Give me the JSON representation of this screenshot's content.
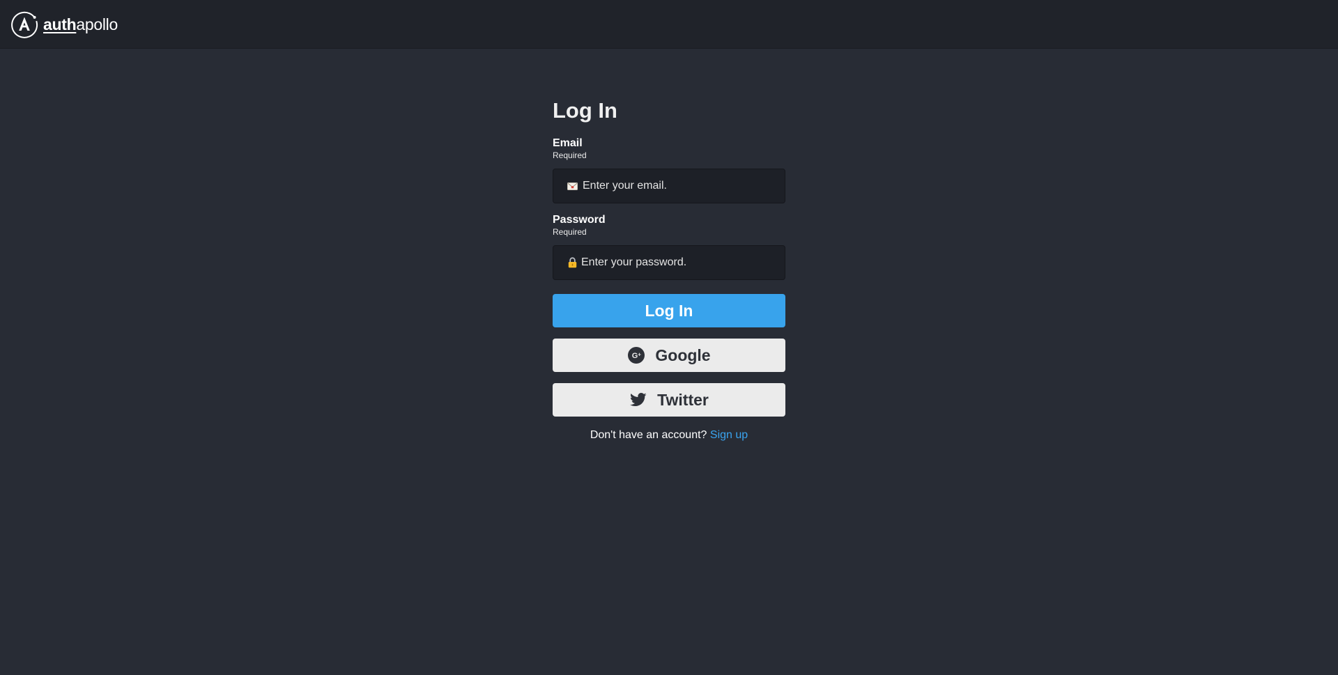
{
  "header": {
    "logo_bold": "auth",
    "logo_light": "apollo"
  },
  "form": {
    "title": "Log In",
    "email": {
      "label": "Email",
      "hint": "Required",
      "placeholder": "Enter your email.",
      "value": "",
      "icon": "envelope-icon"
    },
    "password": {
      "label": "Password",
      "hint": "Required",
      "placeholder": "Enter your password.",
      "value": "",
      "icon": "lock-icon"
    },
    "login_button": "Log In",
    "google_button": "Google",
    "twitter_button": "Twitter",
    "signup_prompt": "Don't have an account?",
    "signup_link": "Sign up"
  },
  "colors": {
    "background": "#282c35",
    "topbar": "#20232a",
    "input_bg": "#1d2027",
    "primary_button": "#38a3ec",
    "social_button": "#ebebeb",
    "link": "#3aa4f0"
  }
}
